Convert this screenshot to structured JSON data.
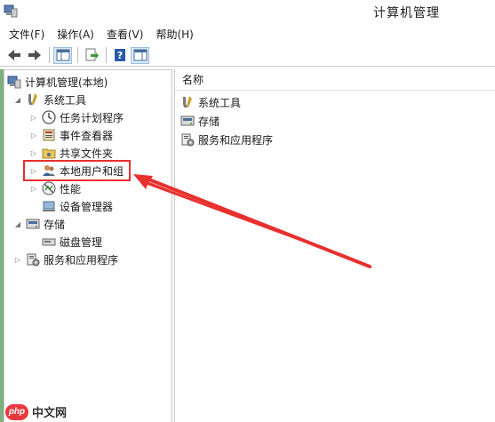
{
  "window": {
    "title": "计算机管理"
  },
  "menu": [
    {
      "label": "文件(F)"
    },
    {
      "label": "操作(A)"
    },
    {
      "label": "查看(V)"
    },
    {
      "label": "帮助(H)"
    }
  ],
  "toolbar": {
    "buttons": [
      "back-icon",
      "forward-icon",
      "show-hide-tree-icon",
      "export-list-icon",
      "help-icon",
      "properties-view-icon"
    ]
  },
  "tree": {
    "root": "计算机管理(本地)",
    "system_tools": "系统工具",
    "task_scheduler": "任务计划程序",
    "event_viewer": "事件查看器",
    "shared_folders": "共享文件夹",
    "local_users": "本地用户和组",
    "performance": "性能",
    "device_manager": "设备管理器",
    "storage": "存储",
    "disk_management": "磁盘管理",
    "services_apps": "服务和应用程序"
  },
  "list": {
    "column_name": "名称",
    "items": [
      {
        "label": "系统工具",
        "icon": "tools-icon"
      },
      {
        "label": "存储",
        "icon": "storage-icon"
      },
      {
        "label": "服务和应用程序",
        "icon": "services-icon"
      }
    ]
  },
  "watermark": {
    "logo": "php",
    "text": "中文网"
  },
  "colors": {
    "highlight": "#e8302e",
    "watermark_logo": "#e8383d"
  }
}
